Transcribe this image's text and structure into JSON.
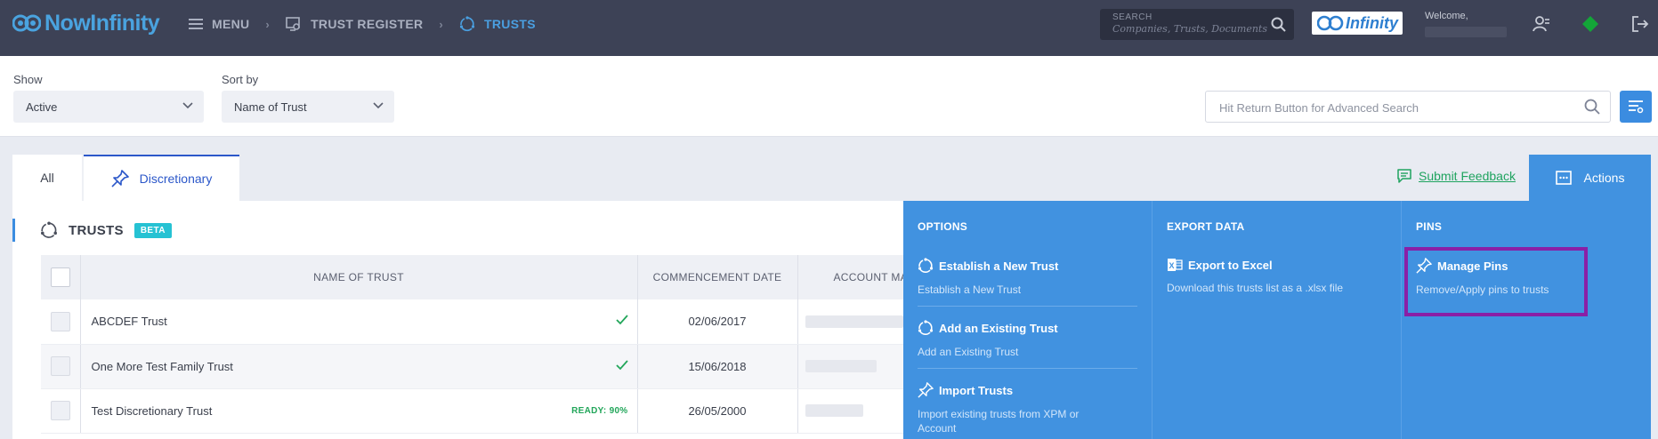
{
  "app": {
    "brand": "NowInfinity",
    "badge_brand": "Infinity"
  },
  "nav": {
    "menu": "MENU",
    "breadcrumbs": [
      "TRUST REGISTER",
      "TRUSTS"
    ]
  },
  "top_search": {
    "label": "SEARCH",
    "placeholder": "Companies, Trusts, Documents"
  },
  "user": {
    "welcome": "Welcome,"
  },
  "filters": {
    "show_label": "Show",
    "show_value": "Active",
    "sort_label": "Sort by",
    "sort_value": "Name of Trust",
    "advanced_search_placeholder": "Hit Return Button for Advanced Search"
  },
  "tabs": [
    {
      "label": "All"
    },
    {
      "label": "Discretionary"
    }
  ],
  "feedback": "Submit Feedback",
  "actions": {
    "label": "Actions"
  },
  "panel": {
    "title": "TRUSTS",
    "badge": "BETA"
  },
  "table": {
    "columns": [
      "NAME OF TRUST",
      "COMMENCEMENT DATE",
      "ACCOUNT MA"
    ],
    "rows": [
      {
        "name": "ABCDEF Trust",
        "status": "check",
        "date": "02/06/2017"
      },
      {
        "name": "One More Test Family Trust",
        "status": "check",
        "date": "15/06/2018"
      },
      {
        "name": "Test Discretionary Trust",
        "status": "READY: 90%",
        "date": "26/05/2000"
      }
    ]
  },
  "dropdown": {
    "options": {
      "heading": "OPTIONS",
      "items": [
        {
          "title": "Establish a New Trust",
          "desc": "Establish a New Trust"
        },
        {
          "title": "Add an Existing Trust",
          "desc": "Add an Existing Trust"
        },
        {
          "title": "Import Trusts",
          "desc": "Import existing trusts from XPM or Account"
        }
      ]
    },
    "export": {
      "heading": "EXPORT DATA",
      "items": [
        {
          "title": "Export to Excel",
          "desc": "Download this trusts list as a .xlsx file"
        }
      ]
    },
    "pins": {
      "heading": "PINS",
      "items": [
        {
          "title": "Manage Pins",
          "desc": "Remove/Apply pins to trusts"
        }
      ]
    }
  },
  "colors": {
    "topbar": "#3d4256",
    "accent": "#4192e0",
    "highlight": "#8a1fa6",
    "success": "#22a65a"
  }
}
